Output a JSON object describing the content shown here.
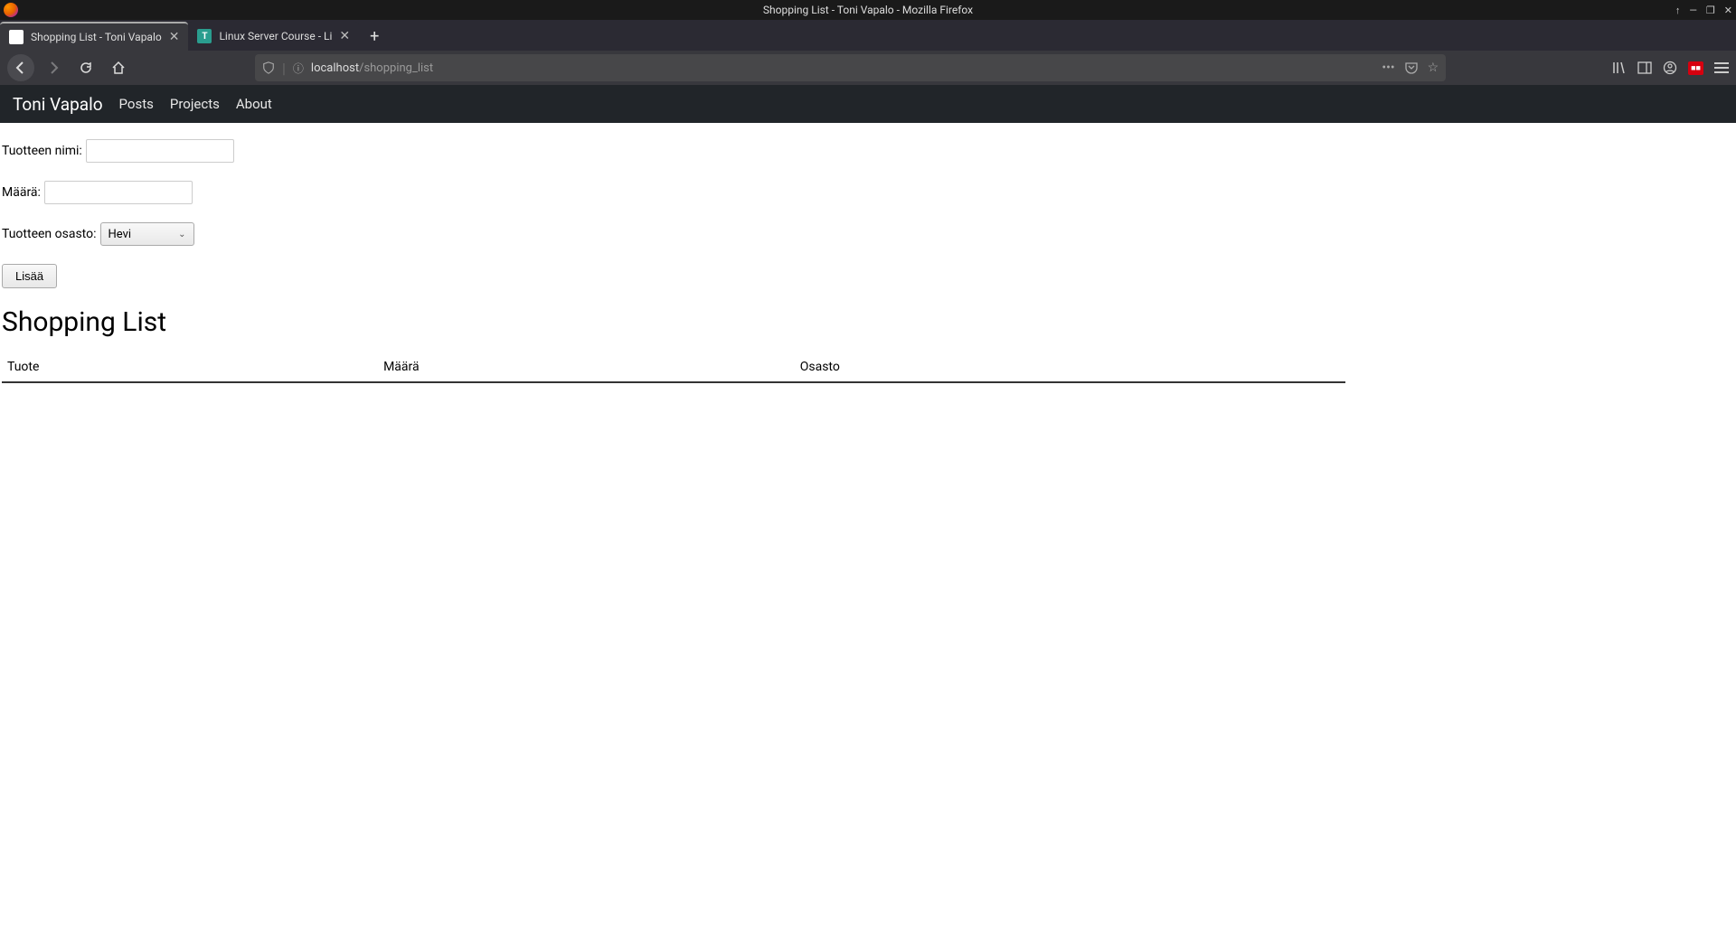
{
  "window": {
    "title": "Shopping List - Toni Vapalo - Mozilla Firefox"
  },
  "tabs": {
    "tab1": "Shopping List - Toni Vapalo",
    "tab2": "Linux Server Course - Li"
  },
  "url": {
    "host": "localhost",
    "path": "/shopping_list"
  },
  "site_nav": {
    "brand": "Toni Vapalo",
    "link1": "Posts",
    "link2": "Projects",
    "link3": "About"
  },
  "form": {
    "name_label": "Tuotteen nimi:",
    "name_value": "",
    "qty_label": "Määrä:",
    "qty_value": "",
    "dept_label": "Tuotteen osasto:",
    "dept_selected": "Hevi",
    "add_button": "Lisää"
  },
  "heading": "Shopping List",
  "table": {
    "col1": "Tuote",
    "col2": "Määrä",
    "col3": "Osasto"
  }
}
